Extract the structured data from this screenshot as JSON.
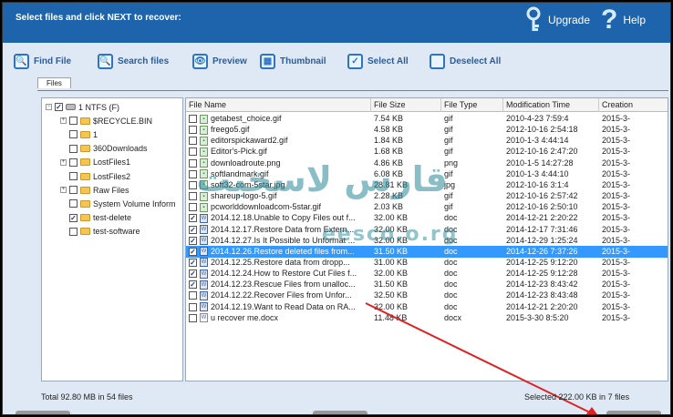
{
  "header": {
    "title": "Select files and click NEXT to recover:",
    "upgrade_label": "Upgrade",
    "help_label": "Help"
  },
  "toolbar": [
    {
      "label": "Find File",
      "icon": "find-file-icon",
      "glyph": "🔍"
    },
    {
      "label": "Search files",
      "icon": "search-files-icon",
      "glyph": "🔍"
    },
    {
      "label": "Preview",
      "icon": "preview-icon",
      "glyph": "👁"
    },
    {
      "label": "Thumbnail",
      "icon": "thumbnail-icon",
      "glyph": "▦"
    },
    {
      "label": "Select All",
      "icon": "select-all-icon",
      "glyph": "✓"
    },
    {
      "label": "Deselect All",
      "icon": "deselect-all-icon",
      "glyph": " "
    }
  ],
  "tabs": {
    "files": "Files"
  },
  "tree": [
    {
      "label": "1 NTFS (F)",
      "level": 0,
      "expand": "−",
      "checked": true,
      "type": "drive"
    },
    {
      "label": "$RECYCLE.BIN",
      "level": 1,
      "expand": "+",
      "checked": false,
      "type": "folder"
    },
    {
      "label": "1",
      "level": 1,
      "expand": "",
      "checked": false,
      "type": "folder"
    },
    {
      "label": "360Downloads",
      "level": 1,
      "expand": "",
      "checked": false,
      "type": "folder"
    },
    {
      "label": "LostFiles1",
      "level": 1,
      "expand": "+",
      "checked": false,
      "type": "folder"
    },
    {
      "label": "LostFiles2",
      "level": 1,
      "expand": "",
      "checked": false,
      "type": "folder"
    },
    {
      "label": "Raw Files",
      "level": 1,
      "expand": "+",
      "checked": false,
      "type": "folder"
    },
    {
      "label": "System Volume Inform",
      "level": 1,
      "expand": "",
      "checked": false,
      "type": "folder"
    },
    {
      "label": "test-delete",
      "level": 1,
      "expand": "",
      "checked": true,
      "type": "folder"
    },
    {
      "label": "test-software",
      "level": 1,
      "expand": "",
      "checked": false,
      "type": "folder"
    }
  ],
  "columns": [
    "File Name",
    "File Size",
    "File Type",
    "Modification Time",
    "Creation"
  ],
  "files": [
    {
      "name": "getabest_choice.gif",
      "size": "7.54 KB",
      "type": "gif",
      "mtime": "2010-4-23 7:59:4",
      "ctime": "2015-3-",
      "checked": false,
      "icon": "img",
      "selected": false
    },
    {
      "name": "freego5.gif",
      "size": "4.58 KB",
      "type": "gif",
      "mtime": "2012-10-16 2:54:18",
      "ctime": "2015-3-",
      "checked": false,
      "icon": "img",
      "selected": false
    },
    {
      "name": "editorspickaward2.gif",
      "size": "1.84 KB",
      "type": "gif",
      "mtime": "2010-1-3 4:44:14",
      "ctime": "2015-3-",
      "checked": false,
      "icon": "img",
      "selected": false
    },
    {
      "name": "Editor's-Pick.gif",
      "size": "1.68 KB",
      "type": "gif",
      "mtime": "2012-10-16 2:47:20",
      "ctime": "2015-3-",
      "checked": false,
      "icon": "img",
      "selected": false
    },
    {
      "name": "downloadroute.png",
      "size": "4.86 KB",
      "type": "png",
      "mtime": "2010-1-5 14:27:28",
      "ctime": "2015-3-",
      "checked": false,
      "icon": "img",
      "selected": false
    },
    {
      "name": "softlandmark.gif",
      "size": "6.08 KB",
      "type": "gif",
      "mtime": "2010-1-3 4:44:10",
      "ctime": "2015-3-",
      "checked": false,
      "icon": "img",
      "selected": false
    },
    {
      "name": "soft32-com-5star.jpg",
      "size": "28.81 KB",
      "type": "jpg",
      "mtime": "2012-10-16 3:1:4",
      "ctime": "2015-3-",
      "checked": false,
      "icon": "img",
      "selected": false
    },
    {
      "name": "shareup-logo-5.gif",
      "size": "2.28 KB",
      "type": "gif",
      "mtime": "2012-10-16 2:57:42",
      "ctime": "2015-3-",
      "checked": false,
      "icon": "img",
      "selected": false
    },
    {
      "name": "pcworlddownloadcom-5star.gif",
      "size": "2.03 KB",
      "type": "gif",
      "mtime": "2012-10-16 2:50:10",
      "ctime": "2015-3-",
      "checked": false,
      "icon": "img",
      "selected": false
    },
    {
      "name": "2014.12.18.Unable to Copy Files out f...",
      "size": "32.00 KB",
      "type": "doc",
      "mtime": "2014-12-21 2:20:22",
      "ctime": "2015-3-",
      "checked": true,
      "icon": "doc",
      "selected": false
    },
    {
      "name": "2014.12.17.Restore Data from Extern...",
      "size": "32.00 KB",
      "type": "doc",
      "mtime": "2014-12-17 7:31:46",
      "ctime": "2015-3-",
      "checked": true,
      "icon": "doc",
      "selected": false
    },
    {
      "name": "2014.12.27.Is It Possible to Unformat ...",
      "size": "32.00 KB",
      "type": "doc",
      "mtime": "2014-12-29 1:25:24",
      "ctime": "2015-3-",
      "checked": true,
      "icon": "doc",
      "selected": false
    },
    {
      "name": "2014.12.26.Restore deleted files from...",
      "size": "31.50 KB",
      "type": "doc",
      "mtime": "2014-12-26 7:37:26",
      "ctime": "2015-3-",
      "checked": true,
      "icon": "doc",
      "selected": true
    },
    {
      "name": "2014.12.25.Restore data from dropp...",
      "size": "31.00 KB",
      "type": "doc",
      "mtime": "2014-12-25 9:12:20",
      "ctime": "2015-3-",
      "checked": true,
      "icon": "doc",
      "selected": false
    },
    {
      "name": "2014.12.24.How to Restore Cut Files f...",
      "size": "32.00 KB",
      "type": "doc",
      "mtime": "2014-12-25 9:12:28",
      "ctime": "2015-3-",
      "checked": true,
      "icon": "doc",
      "selected": false
    },
    {
      "name": "2014.12.23.Rescue Files from unalloc...",
      "size": "31.50 KB",
      "type": "doc",
      "mtime": "2014-12-23 8:43:42",
      "ctime": "2015-3-",
      "checked": true,
      "icon": "doc",
      "selected": false
    },
    {
      "name": "2014.12.22.Recover Files from Unfor...",
      "size": "32.50 KB",
      "type": "doc",
      "mtime": "2014-12-23 8:43:48",
      "ctime": "2015-3-",
      "checked": false,
      "icon": "doc",
      "selected": false
    },
    {
      "name": "2014.12.19.Want to Read Data on RA...",
      "size": "32.00 KB",
      "type": "doc",
      "mtime": "2014-12-21 2:20:20",
      "ctime": "2015-3-",
      "checked": false,
      "icon": "doc",
      "selected": false
    },
    {
      "name": "u recover me.docx",
      "size": "11.48 KB",
      "type": "docx",
      "mtime": "2015-3-30 8:5:20",
      "ctime": "2015-3-",
      "checked": false,
      "icon": "docx",
      "selected": false
    }
  ],
  "watermark": {
    "text": "قارس لاسخيت",
    "sub": "eesco.o.rg"
  },
  "status": {
    "total": "Total 92.80 MB in 54 files",
    "selected": "Selected 222.00 KB in 7 files"
  },
  "colors": {
    "header_bg": "#1e64ac",
    "selected_row": "#3399ff",
    "arrow": "#e02020"
  }
}
